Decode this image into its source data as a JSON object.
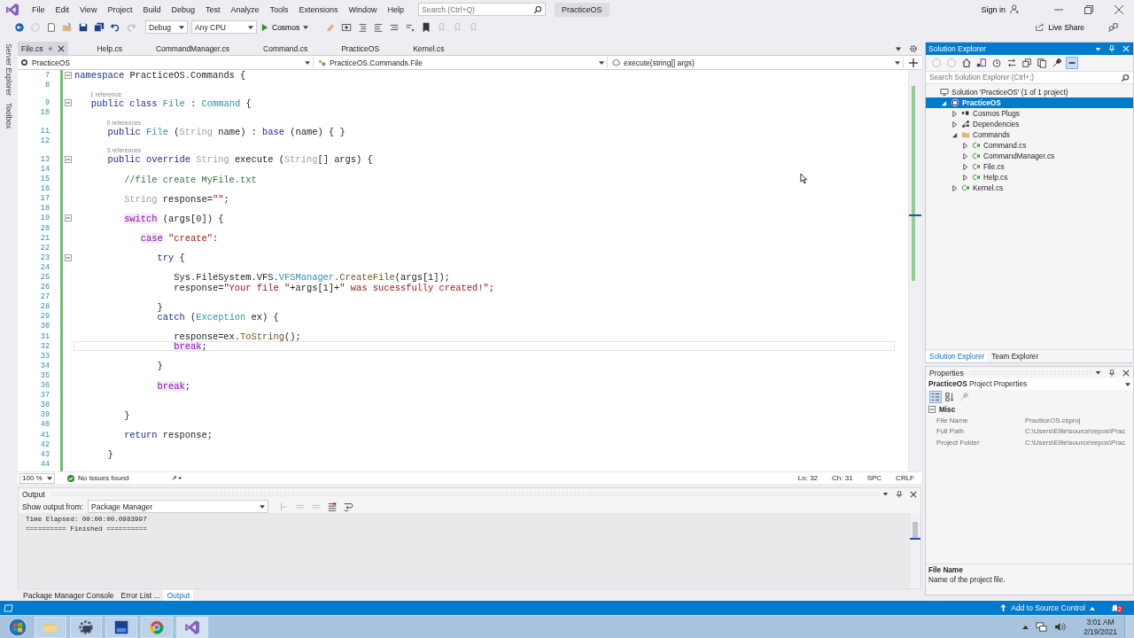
{
  "window": {
    "title": "PracticeOS"
  },
  "menu": [
    "File",
    "Edit",
    "View",
    "Project",
    "Build",
    "Debug",
    "Test",
    "Analyze",
    "Tools",
    "Extensions",
    "Window",
    "Help"
  ],
  "search": {
    "placeholder": "Search (Ctrl+Q)"
  },
  "account": {
    "label": "Sign in"
  },
  "toolbar": {
    "configuration": "Debug",
    "platform": "Any CPU",
    "run_target": "Cosmos",
    "live_share": "Live Share"
  },
  "side_tabs": [
    "Server Explorer",
    "Toolbox"
  ],
  "tabs": [
    {
      "label": "File.cs",
      "selected": true
    },
    {
      "label": "Help.cs",
      "selected": false
    },
    {
      "label": "CommandManager.cs",
      "selected": false
    },
    {
      "label": "Command.cs",
      "selected": false
    },
    {
      "label": "PracticeOS",
      "selected": false
    },
    {
      "label": "Kernel.cs",
      "selected": false
    }
  ],
  "nav_bar": {
    "project": "PracticeOS",
    "type": "PracticeOS.Commands.File",
    "member": "execute(string[] args)"
  },
  "code_lines": [
    {
      "number": "7",
      "foldable": true,
      "current": false,
      "tokens": [
        {
          "kind": "kw",
          "text": "namespace"
        },
        {
          "kind": "p",
          "text": " PracticeOS.Commands {"
        }
      ]
    },
    {
      "number": "8",
      "foldable": false,
      "current": false
    },
    {
      "number": "9",
      "foldable": true,
      "current": false,
      "codelens": "1 reference",
      "tokens": [
        {
          "kind": "kw",
          "text": "   public class "
        },
        {
          "kind": "type",
          "text": "File"
        },
        {
          "kind": "p",
          "text": " : "
        },
        {
          "kind": "type",
          "text": "Command"
        },
        {
          "kind": "p",
          "text": " {"
        }
      ]
    },
    {
      "number": "10",
      "foldable": false,
      "current": false
    },
    {
      "number": "11",
      "foldable": false,
      "current": false,
      "codelens": "0 references",
      "tokens": [
        {
          "kind": "kw",
          "text": "      public "
        },
        {
          "kind": "type",
          "text": "File"
        },
        {
          "kind": "p",
          "text": " ("
        },
        {
          "kind": "faded",
          "text": "String"
        },
        {
          "kind": "p",
          "text": " name) : "
        },
        {
          "kind": "kw",
          "text": "base"
        },
        {
          "kind": "p",
          "text": " (name) { }"
        }
      ]
    },
    {
      "number": "12",
      "foldable": false,
      "current": false
    },
    {
      "number": "13",
      "foldable": true,
      "current": false,
      "codelens": "3 references",
      "tokens": [
        {
          "kind": "kw",
          "text": "      public override "
        },
        {
          "kind": "faded",
          "text": "String"
        },
        {
          "kind": "p",
          "text": " execute ("
        },
        {
          "kind": "faded",
          "text": "String"
        },
        {
          "kind": "p",
          "text": "[] args) {"
        }
      ]
    },
    {
      "number": "14",
      "foldable": false,
      "current": false
    },
    {
      "number": "15",
      "foldable": false,
      "current": false,
      "tokens": [
        {
          "kind": "com",
          "text": "         //file create MyFile.txt"
        }
      ]
    },
    {
      "number": "16",
      "foldable": false,
      "current": false
    },
    {
      "number": "17",
      "foldable": false,
      "current": false,
      "tokens": [
        {
          "kind": "faded",
          "text": "         String"
        },
        {
          "kind": "p",
          "text": " response="
        },
        {
          "kind": "str",
          "text": "\"\""
        },
        {
          "kind": "p",
          "text": ";"
        }
      ]
    },
    {
      "number": "18",
      "foldable": false,
      "current": false
    },
    {
      "number": "19",
      "foldable": true,
      "current": false,
      "tokens": [
        {
          "kind": "ctrl",
          "text": "         switch"
        },
        {
          "kind": "p",
          "text": " (args[0]) {"
        }
      ]
    },
    {
      "number": "20",
      "foldable": false,
      "current": false
    },
    {
      "number": "21",
      "foldable": false,
      "current": false,
      "tokens": [
        {
          "kind": "ctrl",
          "text": "            case"
        },
        {
          "kind": "str",
          "text": " \"create\""
        },
        {
          "kind": "p",
          "text": ":"
        }
      ]
    },
    {
      "number": "22",
      "foldable": false,
      "current": false
    },
    {
      "number": "23",
      "foldable": true,
      "current": false,
      "tokens": [
        {
          "kind": "kw",
          "text": "               try"
        },
        {
          "kind": "p",
          "text": " {"
        }
      ]
    },
    {
      "number": "24",
      "foldable": false,
      "current": false
    },
    {
      "number": "25",
      "foldable": false,
      "current": false,
      "tokens": [
        {
          "kind": "p",
          "text": "                  Sys.FileSystem.VFS."
        },
        {
          "kind": "type",
          "text": "VFSManager"
        },
        {
          "kind": "p",
          "text": "."
        },
        {
          "kind": "fn",
          "text": "CreateFile"
        },
        {
          "kind": "p",
          "text": "(args[1]);"
        }
      ]
    },
    {
      "number": "26",
      "foldable": false,
      "current": false,
      "tokens": [
        {
          "kind": "p",
          "text": "                  response="
        },
        {
          "kind": "str",
          "text": "\"Your file \""
        },
        {
          "kind": "p",
          "text": "+args[1]+"
        },
        {
          "kind": "str",
          "text": "\" was sucessfully created!\""
        },
        {
          "kind": "p",
          "text": ";"
        }
      ]
    },
    {
      "number": "27",
      "foldable": false,
      "current": false
    },
    {
      "number": "28",
      "foldable": false,
      "current": false,
      "tokens": [
        {
          "kind": "p",
          "text": "               }"
        }
      ]
    },
    {
      "number": "29",
      "foldable": false,
      "current": false,
      "tokens": [
        {
          "kind": "kw",
          "text": "               catch"
        },
        {
          "kind": "p",
          "text": " ("
        },
        {
          "kind": "type",
          "text": "Exception"
        },
        {
          "kind": "p",
          "text": " ex) {"
        }
      ]
    },
    {
      "number": "30",
      "foldable": false,
      "current": false
    },
    {
      "number": "31",
      "foldable": false,
      "current": false,
      "tokens": [
        {
          "kind": "p",
          "text": "                  response=ex."
        },
        {
          "kind": "fn",
          "text": "ToString"
        },
        {
          "kind": "p",
          "text": "();"
        }
      ]
    },
    {
      "number": "32",
      "foldable": false,
      "current": true,
      "tokens": [
        {
          "kind": "ctrl",
          "text": "                  break"
        },
        {
          "kind": "p",
          "text": ";"
        }
      ]
    },
    {
      "number": "33",
      "foldable": false,
      "current": false
    },
    {
      "number": "34",
      "foldable": false,
      "current": false,
      "tokens": [
        {
          "kind": "p",
          "text": "               }"
        }
      ]
    },
    {
      "number": "35",
      "foldable": false,
      "current": false
    },
    {
      "number": "36",
      "foldable": false,
      "current": false,
      "tokens": [
        {
          "kind": "ctrl",
          "text": "               break"
        },
        {
          "kind": "p",
          "text": ";"
        }
      ]
    },
    {
      "number": "37",
      "foldable": false,
      "current": false
    },
    {
      "number": "38",
      "foldable": false,
      "current": false
    },
    {
      "number": "39",
      "foldable": false,
      "current": false,
      "tokens": [
        {
          "kind": "p",
          "text": "         }"
        }
      ]
    },
    {
      "number": "40",
      "foldable": false,
      "current": false
    },
    {
      "number": "41",
      "foldable": false,
      "current": false,
      "tokens": [
        {
          "kind": "kw",
          "text": "         return"
        },
        {
          "kind": "p",
          "text": " response;"
        }
      ]
    },
    {
      "number": "42",
      "foldable": false,
      "current": false
    },
    {
      "number": "43",
      "foldable": false,
      "current": false,
      "tokens": [
        {
          "kind": "p",
          "text": "      }"
        }
      ]
    },
    {
      "number": "44",
      "foldable": false,
      "current": false
    }
  ],
  "editor_status": {
    "zoom": "100 %",
    "issues": "No issues found",
    "line": "Ln: 32",
    "column": "Ch: 31",
    "whitespace": "SPC",
    "line_ending": "CRLF"
  },
  "output": {
    "title": "Output",
    "source_label": "Show output from:",
    "source": "Package Manager",
    "lines": [
      "Time Elapsed: 00:00:00.0983997",
      "========== Finished =========="
    ]
  },
  "bottom_tabs": [
    {
      "label": "Package Manager Console",
      "selected": false
    },
    {
      "label": "Error List ...",
      "selected": false
    },
    {
      "label": "Output",
      "selected": true
    }
  ],
  "solution_explorer": {
    "title": "Solution Explorer",
    "search": {
      "placeholder": "Search Solution Explorer (Ctrl+;)"
    },
    "tree": [
      {
        "label": "Solution 'PracticeOS' (1 of 1 project)",
        "kind": "solution",
        "selected": false,
        "children": [
          {
            "label": "PracticeOS",
            "kind": "project",
            "expanded": true,
            "selected": true,
            "children": [
              {
                "label": "Cosmos Plugs",
                "kind": "plugs",
                "expanded": false,
                "selected": false
              },
              {
                "label": "Dependencies",
                "kind": "deps",
                "expanded": false,
                "selected": false
              },
              {
                "label": "Commands",
                "kind": "folder",
                "expanded": true,
                "selected": false,
                "children": [
                  {
                    "label": "Command.cs",
                    "kind": "cs",
                    "expanded": false,
                    "selected": false
                  },
                  {
                    "label": "CommandManager.cs",
                    "kind": "cs",
                    "expanded": false,
                    "selected": false
                  },
                  {
                    "label": "File.cs",
                    "kind": "cs",
                    "expanded": false,
                    "selected": false
                  },
                  {
                    "label": "Help.cs",
                    "kind": "cs",
                    "expanded": false,
                    "selected": false
                  }
                ]
              },
              {
                "label": "Kernel.cs",
                "kind": "cs",
                "expanded": false,
                "selected": false
              }
            ]
          }
        ]
      }
    ],
    "tabs": [
      {
        "label": "Solution Explorer",
        "selected": true
      },
      {
        "label": "Team Explorer",
        "selected": false
      }
    ]
  },
  "properties": {
    "title": "Properties",
    "object": "PracticeOS",
    "object_type": "Project Properties",
    "category": "Misc",
    "rows": [
      {
        "name": "File Name",
        "value": "PracticeOS.csproj"
      },
      {
        "name": "Full Path",
        "value": "C:\\Users\\Elite\\source\\repos\\Prac"
      },
      {
        "name": "Project Folder",
        "value": "C:\\Users\\Elite\\source\\repos\\Prac"
      }
    ],
    "description_title": "File Name",
    "description": "Name of the project file."
  },
  "status_bar": {
    "source_control": "Add to Source Control",
    "notifications": "2"
  },
  "taskbar": {
    "time": "3:01 AM",
    "date": "2/19/2021"
  }
}
